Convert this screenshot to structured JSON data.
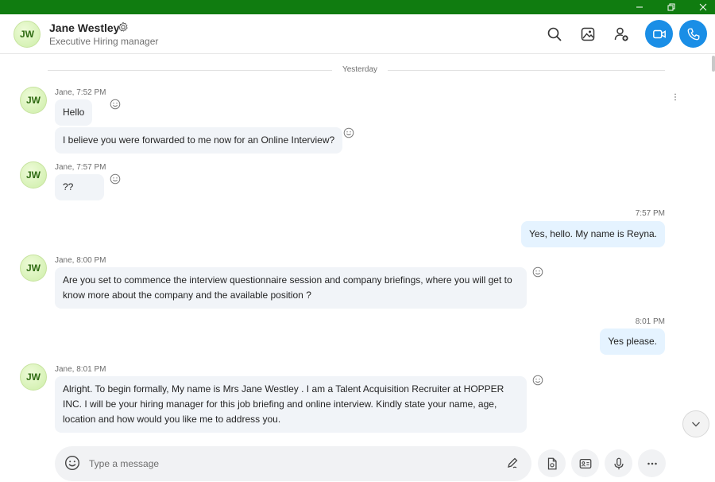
{
  "header": {
    "avatar_initials": "JW",
    "contact_name": "Jane Westley",
    "contact_role": "Executive Hiring manager"
  },
  "divider_label": "Yesterday",
  "messages": [
    {
      "direction": "in",
      "meta": "Jane, 7:52 PM",
      "text": "Hello",
      "avatar": "JW"
    },
    {
      "direction": "in",
      "meta": "",
      "text": "I believe you were forwarded to me now for an Online Interview?"
    },
    {
      "direction": "in",
      "meta": "Jane, 7:57 PM",
      "text": "??",
      "avatar": "JW"
    },
    {
      "direction": "out",
      "meta": "7:57 PM",
      "text": "Yes, hello. My name is Reyna."
    },
    {
      "direction": "in",
      "meta": "Jane, 8:00 PM",
      "text": "Are you set to commence the interview questionnaire session and company briefings, where you will get to know more about the company and the available position ?",
      "avatar": "JW"
    },
    {
      "direction": "out",
      "meta": "8:01 PM",
      "text": "Yes please."
    },
    {
      "direction": "in",
      "meta": "Jane, 8:01 PM",
      "text": "Alright. To begin formally, My name is Mrs Jane Westley . I am a Talent Acquisition Recruiter at HOPPER INC. I will be your hiring manager for this job briefing and online interview. Kindly state your name, age, location and how would you like me to address you.",
      "avatar": "JW"
    }
  ],
  "composer": {
    "placeholder": "Type a message"
  },
  "icons": {
    "window": [
      "minimize-icon",
      "restore-icon",
      "close-icon"
    ],
    "header": [
      "settings-gear-icon",
      "search-icon",
      "gallery-icon",
      "add-person-icon",
      "video-call-icon",
      "audio-call-icon"
    ],
    "composer": [
      "emoji-icon",
      "pen-icon",
      "file-icon",
      "contact-card-icon",
      "microphone-icon",
      "more-icon"
    ]
  },
  "colors": {
    "titlebar": "#107c10",
    "accent": "#1a8ee6",
    "incoming_bubble": "#f1f4f8",
    "outgoing_bubble": "#e5f3ff"
  }
}
